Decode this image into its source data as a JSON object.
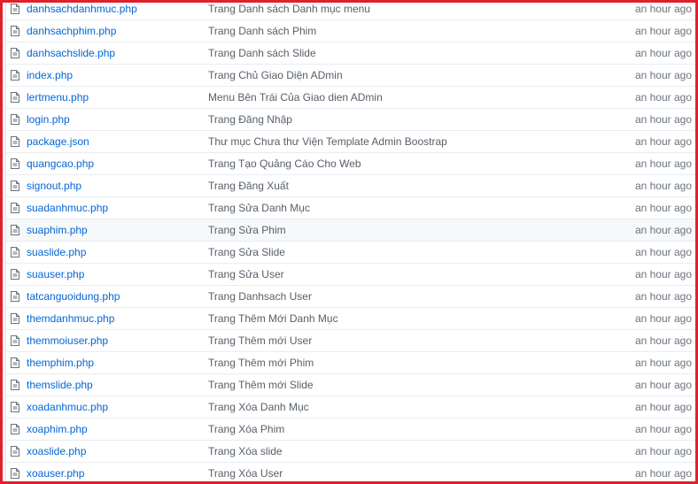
{
  "files": [
    {
      "name": "danhsachdanhmuc.php",
      "message": "Trang Danh sách Danh mục menu",
      "age": "an hour ago"
    },
    {
      "name": "danhsachphim.php",
      "message": "Trang Danh sách Phim",
      "age": "an hour ago"
    },
    {
      "name": "danhsachslide.php",
      "message": "Trang Danh sách Slide",
      "age": "an hour ago"
    },
    {
      "name": "index.php",
      "message": "Trang Chủ Giao Diện ADmin",
      "age": "an hour ago"
    },
    {
      "name": "lertmenu.php",
      "message": "Menu Bên Trái Của Giao dien ADmin",
      "age": "an hour ago"
    },
    {
      "name": "login.php",
      "message": "Trang Đăng Nhập",
      "age": "an hour ago"
    },
    {
      "name": "package.json",
      "message": "Thư mục Chưa thư Viện Template Admin Boostrap",
      "age": "an hour ago"
    },
    {
      "name": "quangcao.php",
      "message": "Trang Tạo Quảng Cáo Cho Web",
      "age": "an hour ago"
    },
    {
      "name": "signout.php",
      "message": "Trang Đăng Xuất",
      "age": "an hour ago"
    },
    {
      "name": "suadanhmuc.php",
      "message": "Trang Sửa Danh Mục",
      "age": "an hour ago"
    },
    {
      "name": "suaphim.php",
      "message": "Trang Sửa Phim",
      "age": "an hour ago"
    },
    {
      "name": "suaslide.php",
      "message": "Trang Sửa Slide",
      "age": "an hour ago"
    },
    {
      "name": "suauser.php",
      "message": "Trang Sửa User",
      "age": "an hour ago"
    },
    {
      "name": "tatcanguoidung.php",
      "message": "Trang Danhsach User",
      "age": "an hour ago"
    },
    {
      "name": "themdanhmuc.php",
      "message": "Trang Thêm Mới Danh Mục",
      "age": "an hour ago"
    },
    {
      "name": "themmoiuser.php",
      "message": "Trang Thêm mới User",
      "age": "an hour ago"
    },
    {
      "name": "themphim.php",
      "message": "Trang Thêm mới Phim",
      "age": "an hour ago"
    },
    {
      "name": "themslide.php",
      "message": "Trang Thêm mới Slide",
      "age": "an hour ago"
    },
    {
      "name": "xoadanhmuc.php",
      "message": "Trang Xóa Danh Mục",
      "age": "an hour ago"
    },
    {
      "name": "xoaphim.php",
      "message": "Trang Xóa Phim",
      "age": "an hour ago"
    },
    {
      "name": "xoaslide.php",
      "message": "Trang Xóa slide",
      "age": "an hour ago"
    },
    {
      "name": "xoauser.php",
      "message": "Trang Xóa User",
      "age": "an hour ago"
    }
  ],
  "icon": "file-icon",
  "colors": {
    "link": "#0366d6",
    "message": "#586069",
    "age": "#6a737d",
    "highlight_border": "#e0202a"
  }
}
